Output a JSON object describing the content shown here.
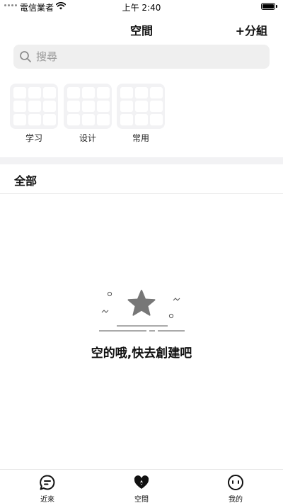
{
  "status_bar": {
    "carrier": "電信業者",
    "time": "上午 2:40"
  },
  "nav": {
    "title": "空間",
    "add_group_label": "+分組"
  },
  "search": {
    "placeholder": "搜尋",
    "value": ""
  },
  "groups": [
    {
      "label": "学习"
    },
    {
      "label": "设计"
    },
    {
      "label": "常用"
    }
  ],
  "section": {
    "title": "全部"
  },
  "empty_state": {
    "message": "空的哦,快去創建吧",
    "icon": "star-icon"
  },
  "tab_bar": {
    "tabs": [
      {
        "label": "近來",
        "icon": "chat-bubble-icon"
      },
      {
        "label": "空間",
        "icon": "space-heart-icon"
      },
      {
        "label": "我的",
        "icon": "face-icon"
      }
    ]
  },
  "colors": {
    "background": "#ffffff",
    "search_bg": "#efefef",
    "folder_bg": "#f2f2f4",
    "divider": "#f2f2f4",
    "text": "#111111",
    "star": "#777777"
  }
}
